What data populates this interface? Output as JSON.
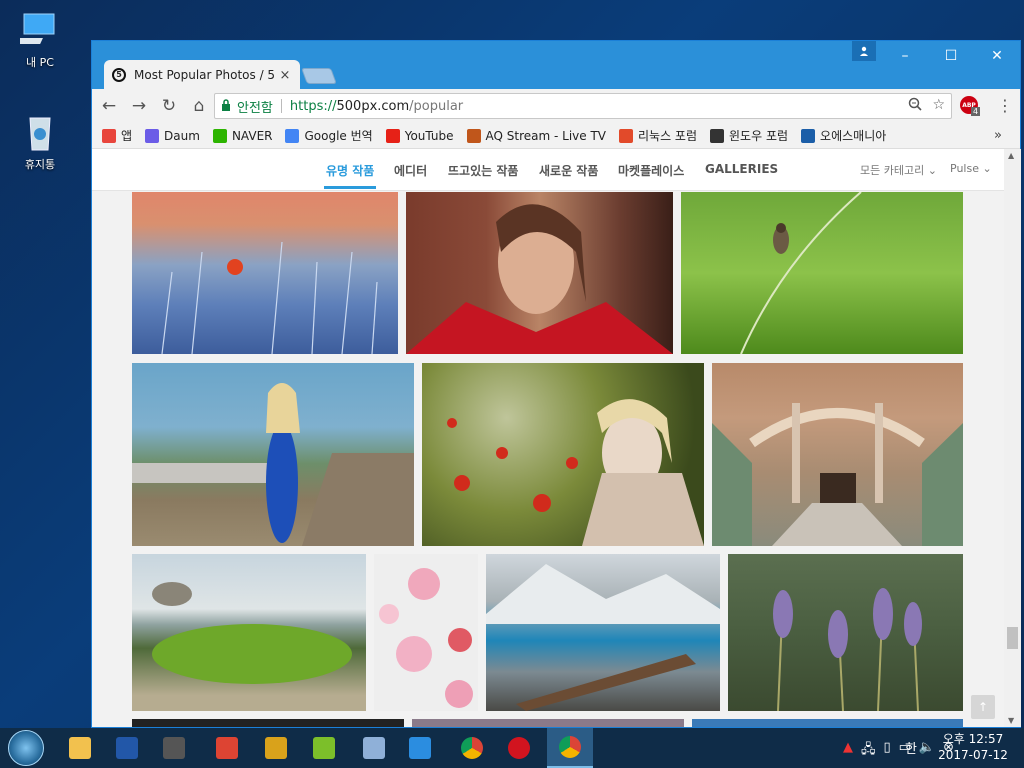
{
  "desktop": {
    "icons": [
      {
        "label": "내 PC",
        "icon": "computer-icon"
      },
      {
        "label": "휴지통",
        "icon": "recycle-bin-icon"
      }
    ]
  },
  "browser": {
    "tab_title": "Most Popular Photos / 5",
    "tab_close": "×",
    "profile_icon": "person-icon",
    "window_controls": {
      "minimize": "–",
      "maximize": "☐",
      "close": "✕"
    },
    "nav": {
      "back": "←",
      "forward": "→",
      "reload": "↻",
      "home": "⌂"
    },
    "address": {
      "security_label": "안전함",
      "scheme": "https://",
      "host": "500px.com",
      "path": "/popular"
    },
    "extension_badge": "ABP",
    "extension_count": "4",
    "bookmarks": [
      {
        "label": "앱",
        "icon": "apps-grid-icon",
        "color": "#e8453c"
      },
      {
        "label": "Daum",
        "icon": "daum-icon",
        "color": "#6b5ce7"
      },
      {
        "label": "NAVER",
        "icon": "naver-icon",
        "color": "#2db400"
      },
      {
        "label": "Google 번역",
        "icon": "google-translate-icon",
        "color": "#4285f4"
      },
      {
        "label": "YouTube",
        "icon": "youtube-icon",
        "color": "#e62117"
      },
      {
        "label": "AQ Stream - Live TV",
        "icon": "aq-stream-icon",
        "color": "#c0561b"
      },
      {
        "label": "리눅스 포럼",
        "icon": "linux-forum-icon",
        "color": "#e24a2a"
      },
      {
        "label": "윈도우 포럼",
        "icon": "windows-forum-icon",
        "color": "#333333"
      },
      {
        "label": "오에스매니아",
        "icon": "osmania-icon",
        "color": "#1b5ea8"
      }
    ],
    "bookmarks_more": "»"
  },
  "site": {
    "nav_items": [
      "유명 작품",
      "에디터",
      "뜨고있는 작품",
      "새로운 작품",
      "마켓플레이스",
      "GALLERIES"
    ],
    "category_filter": "모든 카테고리",
    "sort_filter": "Pulse",
    "accent_color": "#2a9bdc",
    "photos": [
      {
        "subject": "sunset-frost-grass"
      },
      {
        "subject": "woman-portrait-red"
      },
      {
        "subject": "bird-on-grass"
      },
      {
        "subject": "woman-blue-dress-dock"
      },
      {
        "subject": "woman-poppies"
      },
      {
        "subject": "abandoned-hall"
      },
      {
        "subject": "mossy-beach"
      },
      {
        "subject": "pink-peonies"
      },
      {
        "subject": "mountain-lake"
      },
      {
        "subject": "lavender"
      }
    ],
    "back_to_top": "↑"
  },
  "taskbar": {
    "apps": [
      "file-explorer-icon",
      "save-icon",
      "camera-app-icon",
      "color-app-icon",
      "r-app-icon",
      "lime-app-icon",
      "network-app-icon",
      "media-player-icon",
      "chrome-icon",
      "opera-icon",
      "chrome-active-icon"
    ],
    "ime": "한",
    "time": "오후 12:57",
    "date": "2017-07-12"
  }
}
